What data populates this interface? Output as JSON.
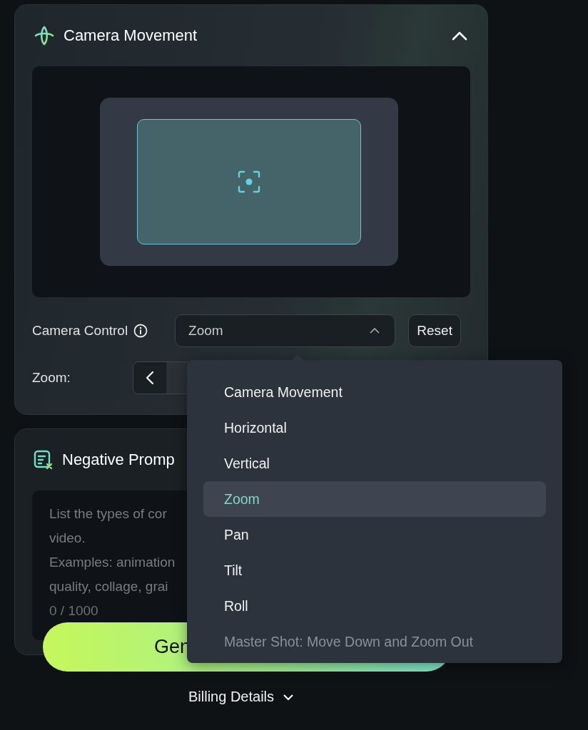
{
  "camera_panel": {
    "title": "Camera Movement",
    "expanded": true,
    "control_label": "Camera Control",
    "select": {
      "value": "Zoom",
      "expanded": true
    },
    "reset_button": "Reset",
    "zoom_label": "Zoom:"
  },
  "dropdown": {
    "options": [
      {
        "label": "Camera Movement",
        "selected": false,
        "disabled": false
      },
      {
        "label": "Horizontal",
        "selected": false,
        "disabled": false
      },
      {
        "label": "Vertical",
        "selected": false,
        "disabled": false
      },
      {
        "label": "Zoom",
        "selected": true,
        "disabled": false
      },
      {
        "label": "Pan",
        "selected": false,
        "disabled": false
      },
      {
        "label": "Tilt",
        "selected": false,
        "disabled": false
      },
      {
        "label": "Roll",
        "selected": false,
        "disabled": false
      },
      {
        "label": "Master Shot: Move Down and Zoom Out",
        "selected": false,
        "disabled": true
      }
    ]
  },
  "negative_prompt": {
    "title": "Negative Promp",
    "placeholder_lines": [
      "List the types of cor",
      "video.",
      "Examples: animation",
      "quality, collage, grai"
    ],
    "counter": "0 / 1000"
  },
  "generate_button": "Gen",
  "billing": {
    "label": "Billing Details",
    "expanded": false
  }
}
